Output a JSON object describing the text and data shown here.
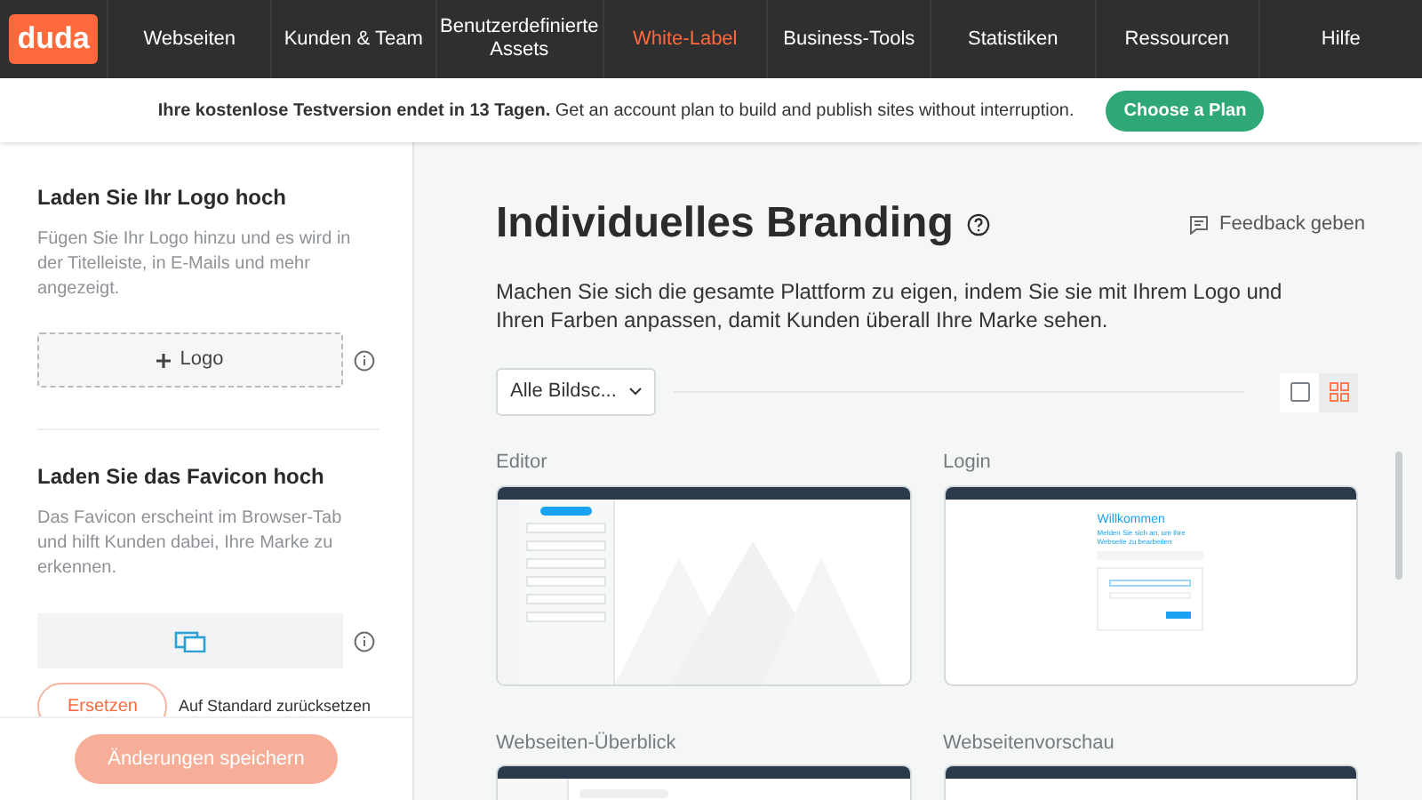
{
  "nav": {
    "logo": "duda",
    "items": [
      {
        "label": "Webseiten",
        "selected": false
      },
      {
        "label": "Kunden & Team",
        "selected": false
      },
      {
        "label": "Benutzerdefinierte Assets",
        "selected": false
      },
      {
        "label": "White-Label",
        "selected": true
      },
      {
        "label": "Business-Tools",
        "selected": false
      },
      {
        "label": "Statistiken",
        "selected": false
      },
      {
        "label": "Ressourcen",
        "selected": false
      },
      {
        "label": "Hilfe",
        "selected": false
      }
    ]
  },
  "banner": {
    "text": "**Ihre kostenlose Testversion endet in 13 Tagen.** Get an account plan to build and publish sites without interruption.",
    "button": "Choose a Plan"
  },
  "sidebar": {
    "logo_section": {
      "title": "Laden Sie Ihr Logo hoch",
      "description": "Fügen Sie Ihr Logo hinzu und es wird in der Titelleiste, in E-Mails und mehr angezeigt.",
      "upload_button": "Logo"
    },
    "favicon_section": {
      "title": "Laden Sie das Favicon hoch",
      "description": "Das Favicon erscheint im Browser-Tab und hilft Kunden dabei, Ihre Marke zu erkennen.",
      "replace_button": "Ersetzen",
      "reset_link": "Auf Standard zurücksetzen"
    },
    "save_button": {
      "label": "Änderungen speichern",
      "disabled": true
    }
  },
  "main": {
    "title": "Individuelles Branding",
    "feedback": "Feedback geben",
    "description": "Machen Sie sich die gesamte Plattform zu eigen, indem Sie sie mit Ihrem Logo und Ihren Farben anpassen, damit Kunden überall Ihre Marke sehen.",
    "filter": "Alle Bildsc...",
    "view_toggle": [
      {
        "kind": "single",
        "selected": false
      },
      {
        "kind": "grid",
        "selected": true
      }
    ],
    "previews": [
      {
        "label": "Editor",
        "kind": "editor"
      },
      {
        "label": "Login",
        "kind": "login",
        "heading": "Willkommen",
        "subheading": "Melden Sie sich an, um Ihre Webseite zu bearbeiten"
      },
      {
        "label": "Webseiten-Überblick",
        "kind": "overview"
      },
      {
        "label": "Webseitenvorschau",
        "kind": "preview"
      }
    ]
  }
}
